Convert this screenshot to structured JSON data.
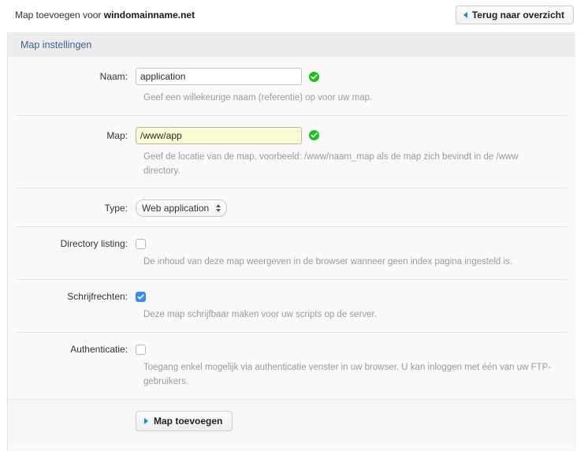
{
  "header": {
    "title_prefix": "Map toevoegen voor ",
    "domain": "windomainname.net",
    "back_button_label": "Terug naar overzicht",
    "back_icon": "triangle-left-icon"
  },
  "panel": {
    "header_title": "Map instellingen"
  },
  "form": {
    "rows": [
      {
        "label": "Naam:",
        "type": "text",
        "value": "application",
        "placeholder": "",
        "highlighted": false,
        "valid": true,
        "valid_icon": "green-check-circle-icon",
        "help": "Geef een willekeurige naam (referentie) op voor uw map."
      },
      {
        "label": "Map:",
        "type": "text",
        "value": "/www/app",
        "placeholder": "",
        "highlighted": true,
        "valid": true,
        "valid_icon": "green-check-circle-icon",
        "help": "Geef de locatie van de map, voorbeeld: /www/naam_map als de map zich bevindt in de /www directory."
      },
      {
        "label": "Type:",
        "type": "select",
        "value": "Web application",
        "help": ""
      },
      {
        "label": "Directory listing:",
        "type": "checkbox",
        "checked": false,
        "help": "De inhoud van deze map weergeven in de browser wanneer geen index pagina ingesteld is."
      },
      {
        "label": "Schrijfrechten:",
        "type": "checkbox",
        "checked": true,
        "help": "Deze map schrijfbaar maken voor uw scripts op de server."
      },
      {
        "label": "Authenticatie:",
        "type": "checkbox",
        "checked": false,
        "help": "Toegang enkel mogelijk via authenticatie venster in uw browser. U kan inloggen met één van uw FTP-gebruikers."
      }
    ],
    "submit_label": "Map toevoegen",
    "submit_icon": "triangle-right-icon"
  },
  "colors": {
    "accent_blue": "#1a8fc1",
    "panel_header_title": "#3c648f",
    "valid_green": "#19c119",
    "checkbox_checked": "#3b8cec",
    "highlight_yellow": "#fafbd2"
  }
}
